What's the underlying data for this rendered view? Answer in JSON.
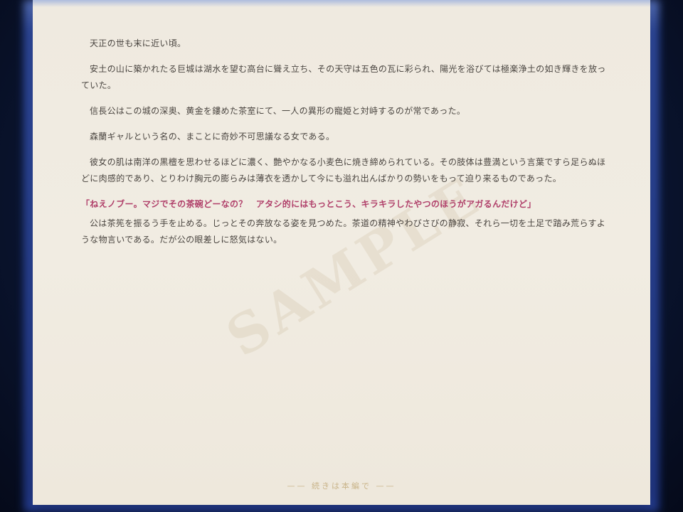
{
  "paragraphs": [
    "天正の世も末に近い頃。",
    "安土の山に築かれたる巨城は湖水を望む高台に聳え立ち、その天守は五色の瓦に彩られ、陽光を浴びては極楽浄土の如き輝きを放っていた。",
    "信長公はこの城の深奥、黄金を鏤めた茶室にて、一人の異形の寵姫と対峙するのが常であった。",
    "森蘭ギャルという名の、まことに奇妙不可思議なる女である。",
    "彼女の肌は南洋の黒檀を思わせるほどに濃く、艶やかなる小麦色に焼き締められている。その肢体は豊満という言葉ですら足らぬほどに肉感的であり、とりわけ胸元の膨らみは薄衣を透かして今にも溢れ出んばかりの勢いをもって迫り来るものであった。"
  ],
  "dialogue": "「ねえノブー。マジでその茶碗どーなの？　アタシ的にはもっとこう、キラキラしたやつのほうがアガるんだけど」",
  "after_dialogue": "公は茶筅を振るう手を止める。じっとその奔放なる姿を見つめた。茶道の精神やわびさびの静寂、それら一切を土足で踏み荒らすような物言いである。だが公の眼差しに怒気はない。",
  "watermark": "SAMPLE",
  "footer": "—— 続きは本編で ——",
  "colors": {
    "paper": "#efeae0",
    "body_text": "#4a4540",
    "dialogue_text": "#b0406a",
    "footer_text": "#c9b48a",
    "frame": "#2a46a8"
  }
}
